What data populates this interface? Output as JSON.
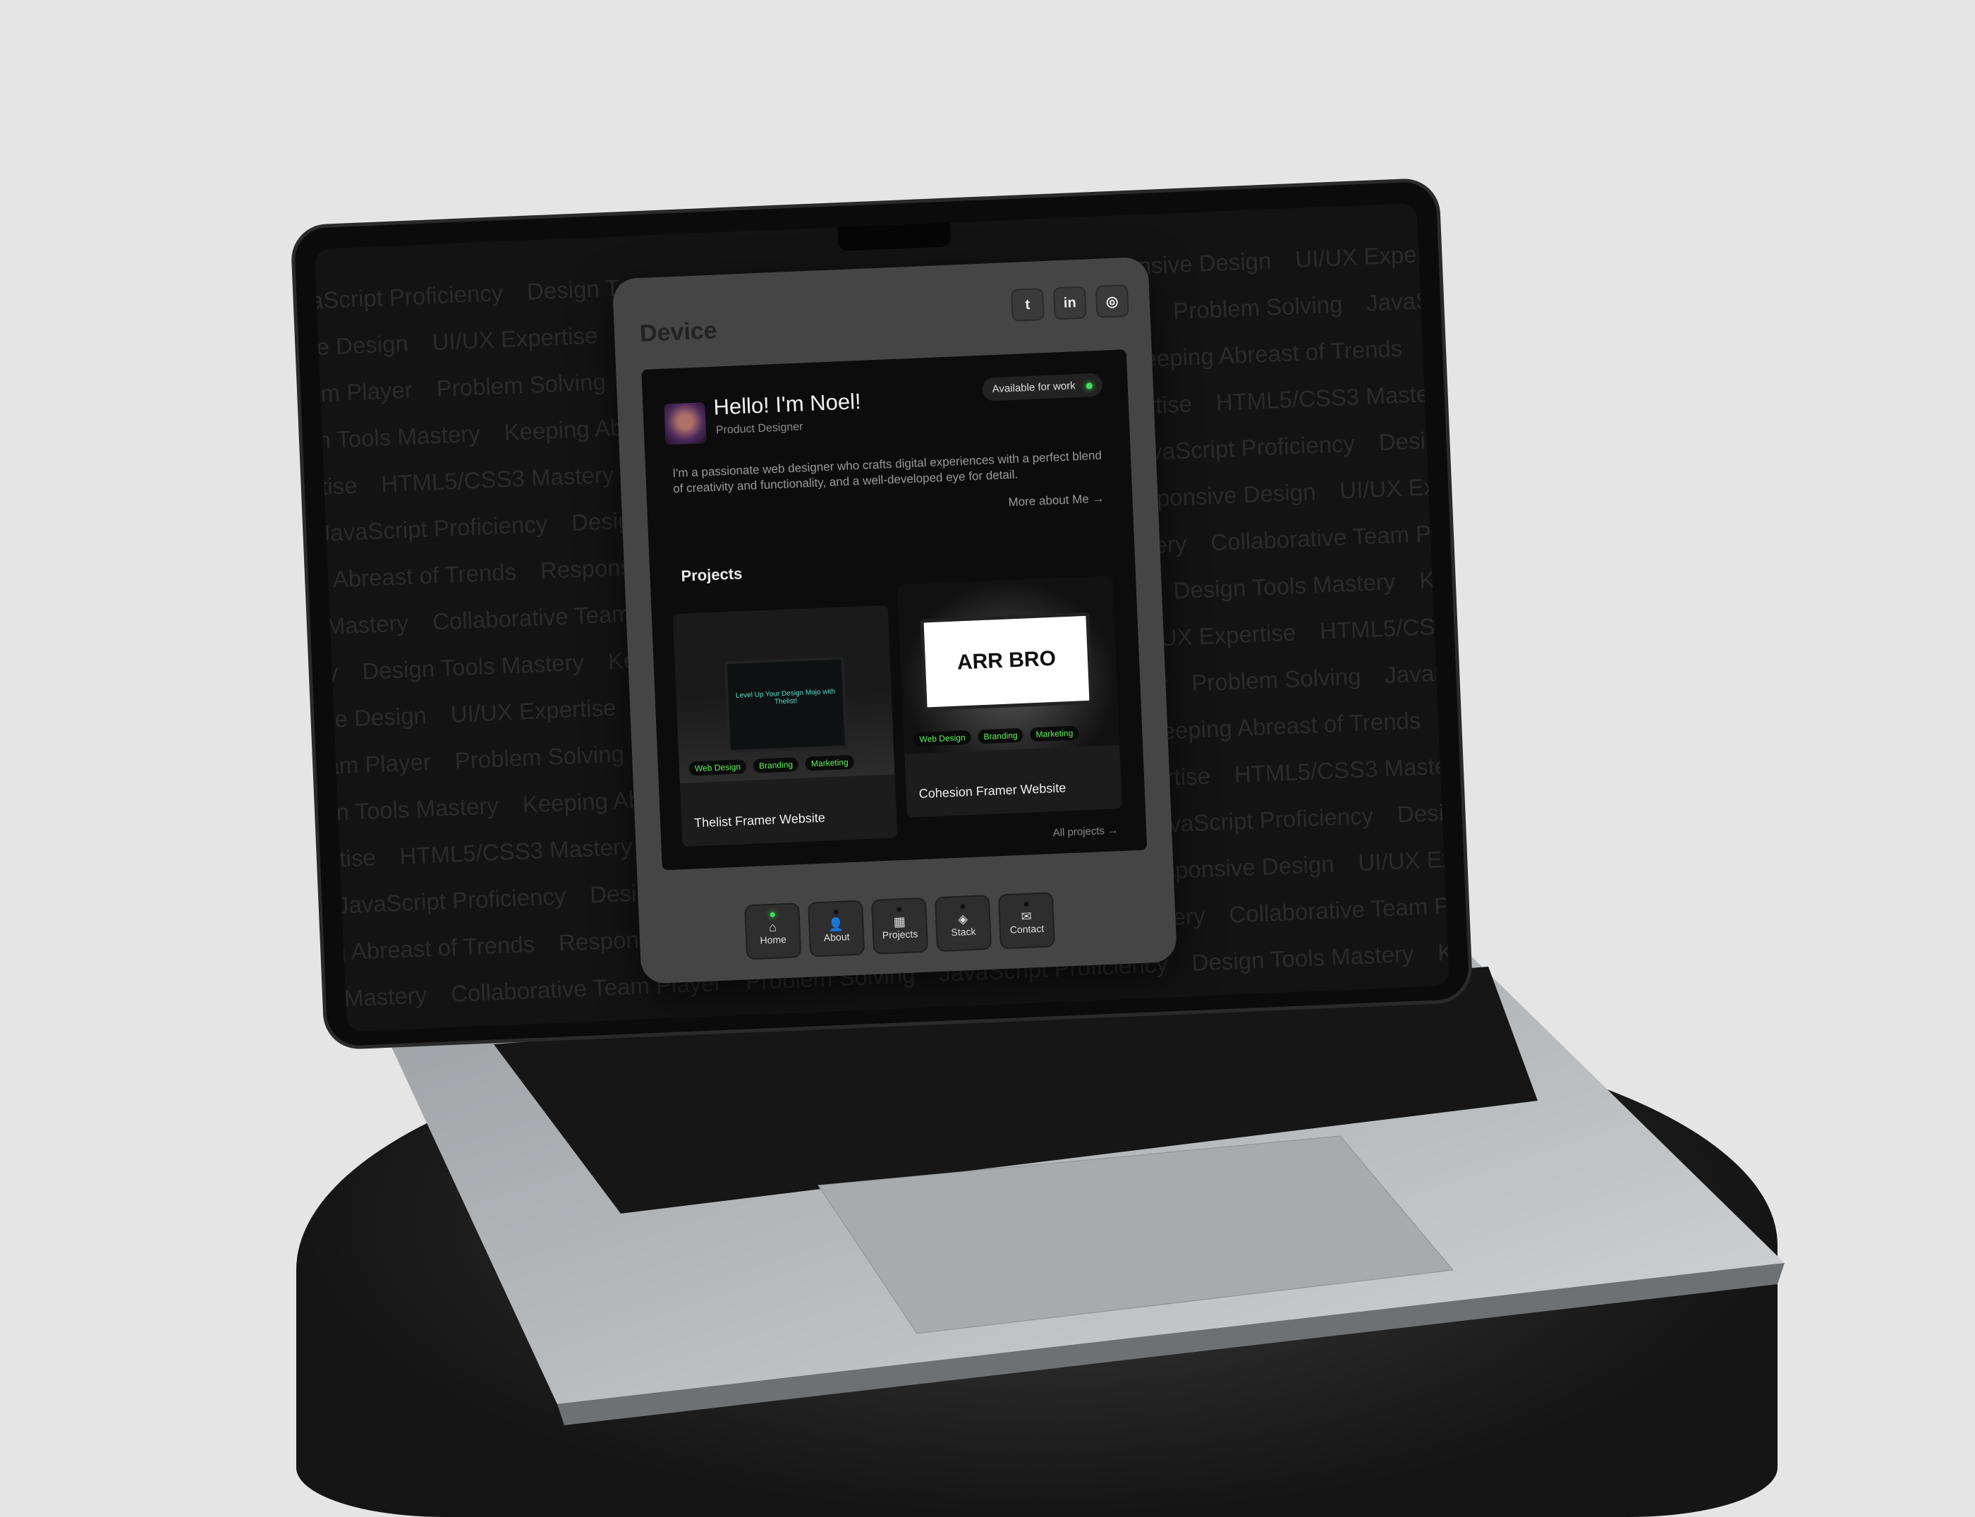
{
  "background_skills": [
    "JavaScript Proficiency",
    "Design Tools Mastery",
    "Keeping Abreast of Trends",
    "Responsive Design",
    "UI/UX Expertise",
    "HTML5/CSS3 Mastery",
    "Collaborative Team Player",
    "Problem Solving"
  ],
  "card": {
    "brand": "Device",
    "socials": [
      {
        "icon": "twitter-icon",
        "glyph": "t"
      },
      {
        "icon": "linkedin-icon",
        "glyph": "in"
      },
      {
        "icon": "instagram-icon",
        "glyph": "◎"
      }
    ],
    "greeting": "Hello! I'm Noel!",
    "role": "Product Designer",
    "availability": "Available for work",
    "status_color": "#3ee05a",
    "bio": "I'm a passionate web designer who crafts digital experiences with a perfect blend of creativity and functionality, and a well-developed eye for detail.",
    "more_link": "More about Me →",
    "projects_title": "Projects",
    "projects": [
      {
        "name": "Thelist Framer Website",
        "preview_text": "Level Up Your Design Mojo with Thelist!",
        "tags": [
          "Web Design",
          "Branding",
          "Marketing"
        ]
      },
      {
        "name": "Cohesion Framer Website",
        "preview_text": "ARR BRO",
        "tags": [
          "Web Design",
          "Branding",
          "Marketing"
        ]
      }
    ],
    "all_projects": "All projects →",
    "nav": [
      {
        "label": "Home",
        "glyph": "⌂",
        "icon": "home-icon",
        "active": true
      },
      {
        "label": "About",
        "glyph": "👤",
        "icon": "user-icon"
      },
      {
        "label": "Projects",
        "glyph": "▦",
        "icon": "grid-icon"
      },
      {
        "label": "Stack",
        "glyph": "◈",
        "icon": "layers-icon"
      },
      {
        "label": "Contact",
        "glyph": "✉",
        "icon": "mail-icon"
      }
    ]
  }
}
